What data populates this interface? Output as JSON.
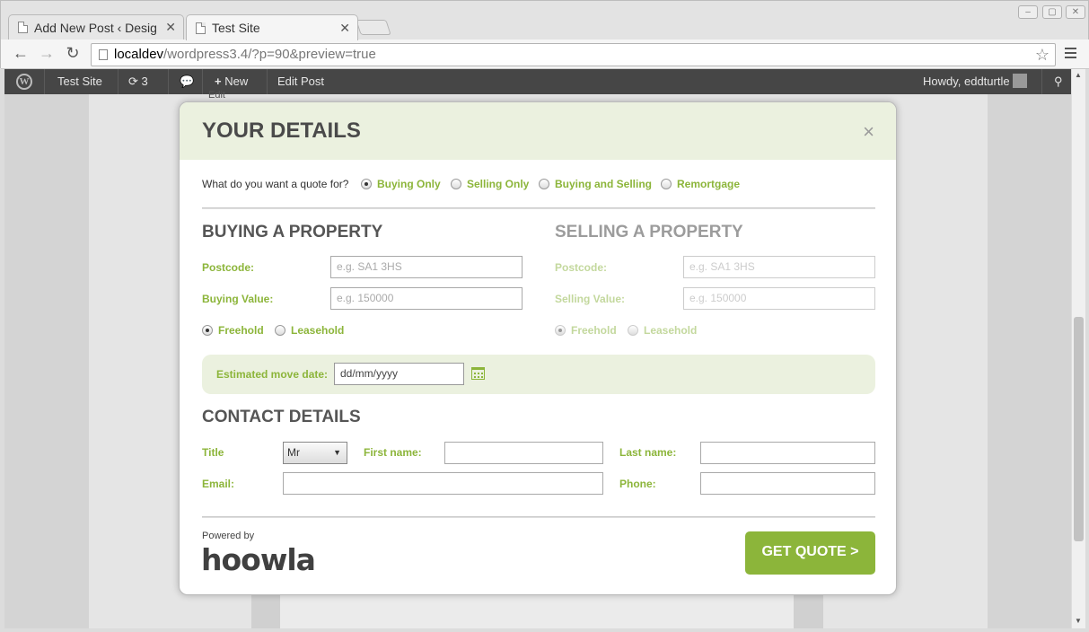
{
  "browser": {
    "tabs": [
      {
        "label": "Add New Post ‹ Desig"
      },
      {
        "label": "Test Site"
      }
    ],
    "url_host": "localdev",
    "url_path": "/wordpress3.4/?p=90&preview=true"
  },
  "adminbar": {
    "site": "Test Site",
    "updates_count": "3",
    "new_label": "New",
    "edit_post": "Edit Post",
    "howdy": "Howdy, eddturtle"
  },
  "page": {
    "edit_label": "Edit"
  },
  "modal": {
    "title": "YOUR DETAILS",
    "close": "×",
    "quote_question": "What do you want a quote for?",
    "quote_options": [
      {
        "label": "Buying Only",
        "selected": true
      },
      {
        "label": "Selling Only",
        "selected": false
      },
      {
        "label": "Buying and Selling",
        "selected": false
      },
      {
        "label": "Remortgage",
        "selected": false
      }
    ],
    "buying": {
      "heading": "BUYING A PROPERTY",
      "postcode_label": "Postcode:",
      "postcode_placeholder": "e.g. SA1 3HS",
      "value_label": "Buying Value:",
      "value_placeholder": "e.g. 150000",
      "freehold": "Freehold",
      "leasehold": "Leasehold"
    },
    "selling": {
      "heading": "SELLING A PROPERTY",
      "postcode_label": "Postcode:",
      "postcode_placeholder": "e.g. SA1 3HS",
      "value_label": "Selling Value:",
      "value_placeholder": "e.g. 150000",
      "freehold": "Freehold",
      "leasehold": "Leasehold"
    },
    "move_date": {
      "label": "Estimated move date:",
      "placeholder": "dd/mm/yyyy"
    },
    "contact": {
      "heading": "CONTACT DETAILS",
      "title_label": "Title",
      "title_value": "Mr",
      "first_name_label": "First name:",
      "last_name_label": "Last name:",
      "email_label": "Email:",
      "phone_label": "Phone:"
    },
    "powered_by": "Powered by",
    "brand": "hoowla",
    "submit": "GET QUOTE >"
  }
}
